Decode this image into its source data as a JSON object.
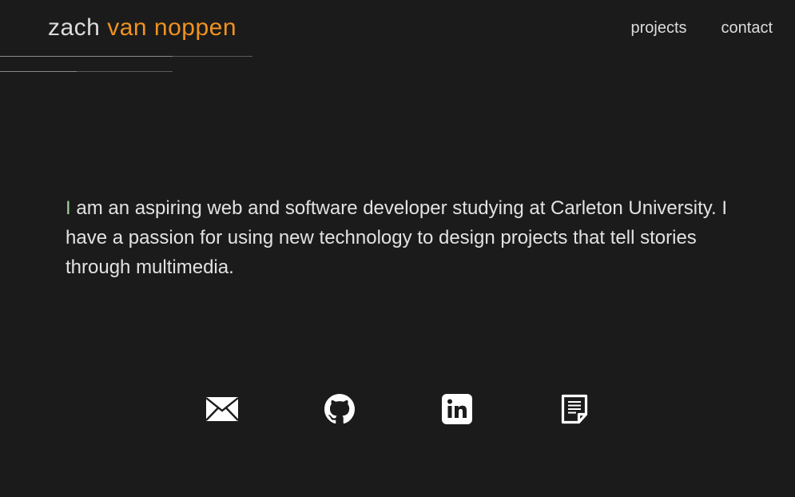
{
  "header": {
    "logo_first": "zach",
    "logo_last": "van noppen",
    "nav": [
      {
        "label": "projects"
      },
      {
        "label": "contact"
      }
    ]
  },
  "intro": {
    "first_letter": "I",
    "text": " am an aspiring web and software developer studying at Carleton University. I have a passion for using new technology to design projects that tell stories through multimedia."
  },
  "socials": [
    {
      "icon": "envelope-icon"
    },
    {
      "icon": "github-icon"
    },
    {
      "icon": "linkedin-icon"
    },
    {
      "icon": "resume-document-icon"
    }
  ],
  "colors": {
    "background": "#1b1b1b",
    "accent": "#f0921f",
    "text": "#e2e2e2",
    "first_letter": "#9fd0a0"
  }
}
